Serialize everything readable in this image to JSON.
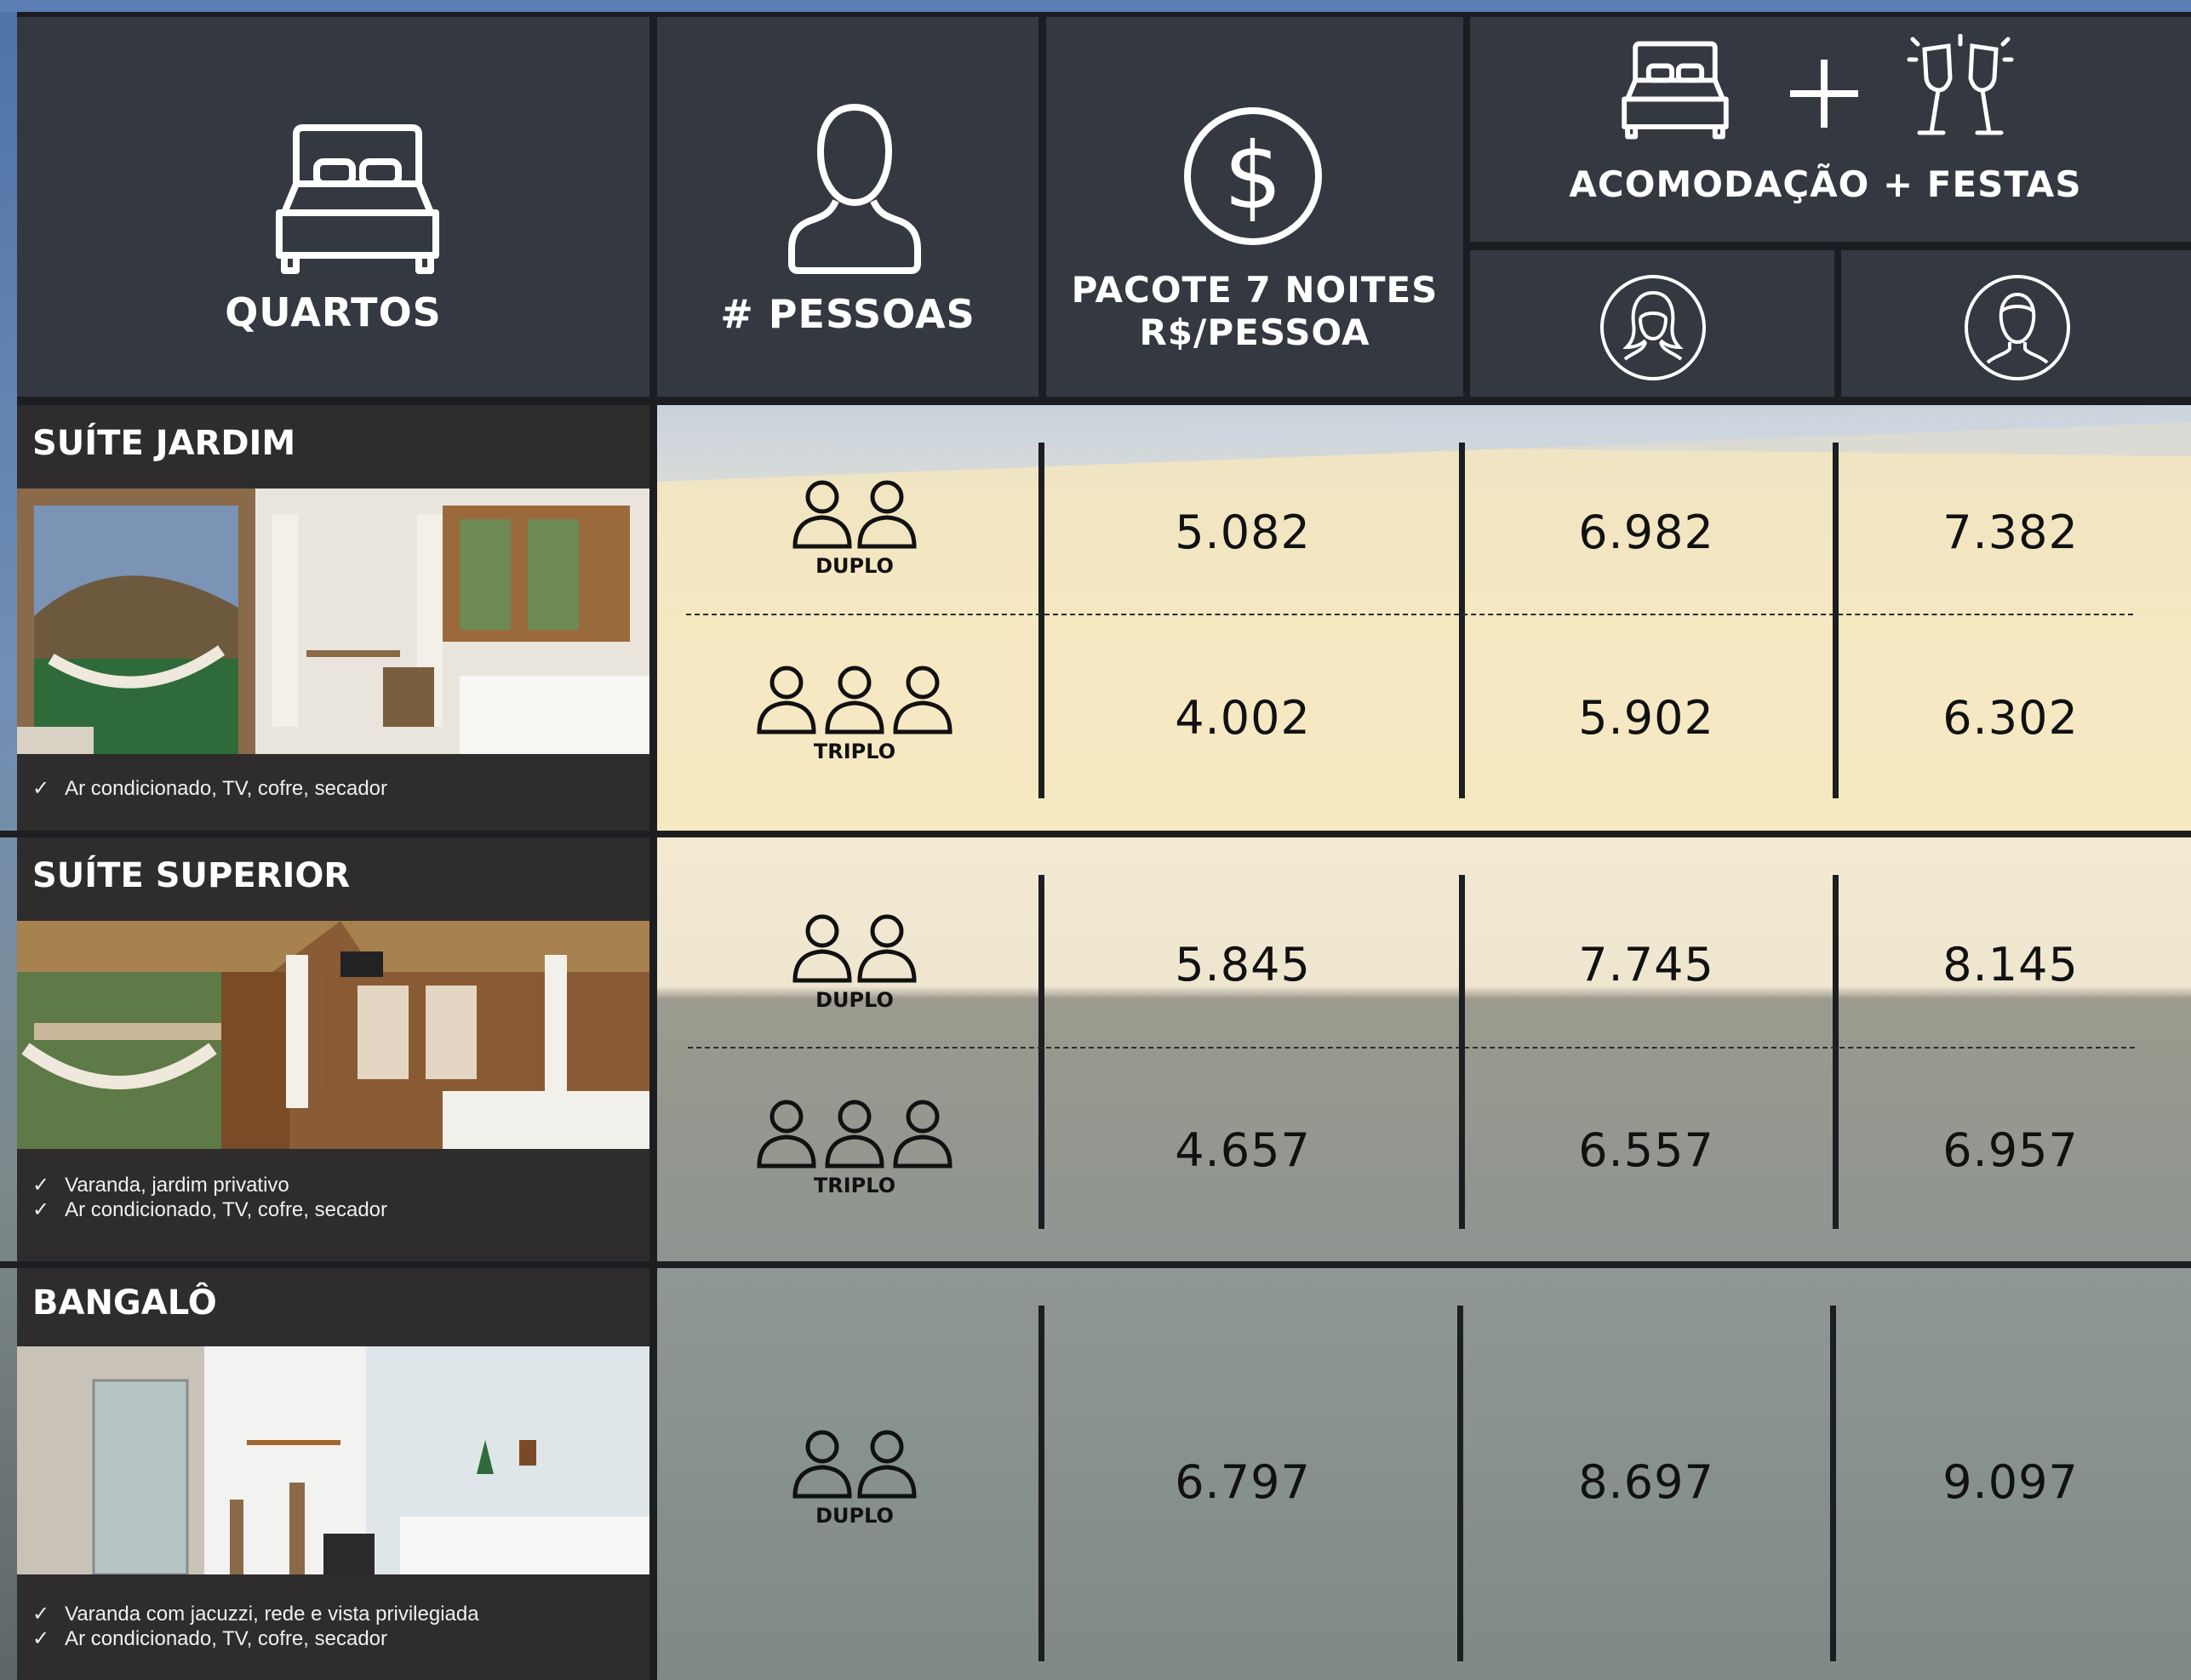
{
  "header": {
    "quartos": {
      "label": "QUARTOS",
      "icon": "bed-icon"
    },
    "pessoas": {
      "label": "# PESSOAS",
      "icon": "person-icon"
    },
    "pacote": {
      "line1": "PACOTE 7 NOITES",
      "line2": "R$/PESSOA",
      "icon": "dollar-icon"
    },
    "festas": {
      "label": "ACOMODAÇÃO + FESTAS",
      "icons": [
        "bed-icon",
        "plus-icon",
        "champagne-icon"
      ]
    },
    "gender_icons": [
      "female-icon",
      "male-icon"
    ]
  },
  "rooms": [
    {
      "name": "SUÍTE JARDIM",
      "features": [
        "Ar condicionado, TV, cofre, secador"
      ],
      "rows": [
        {
          "type": "DUPLO",
          "pacote": "5.082",
          "female": "6.982",
          "male": "7.382"
        },
        {
          "type": "TRIPLO",
          "pacote": "4.002",
          "female": "5.902",
          "male": "6.302"
        }
      ]
    },
    {
      "name": "SUÍTE SUPERIOR",
      "features": [
        "Varanda, jardim privativo",
        "Ar condicionado, TV, cofre, secador"
      ],
      "rows": [
        {
          "type": "DUPLO",
          "pacote": "5.845",
          "female": "7.745",
          "male": "8.145"
        },
        {
          "type": "TRIPLO",
          "pacote": "4.657",
          "female": "6.557",
          "male": "6.957"
        }
      ]
    },
    {
      "name": "BANGALÔ",
      "features": [
        "Varanda com jacuzzi, rede e vista privilegiada",
        "Ar condicionado, TV, cofre, secador"
      ],
      "rows": [
        {
          "type": "DUPLO",
          "pacote": "6.797",
          "female": "8.697",
          "male": "9.097"
        }
      ]
    }
  ],
  "checkmark": "✓",
  "colors": {
    "header_bg": "#343841",
    "divider": "#1c1e22",
    "text_dark": "#111111"
  }
}
